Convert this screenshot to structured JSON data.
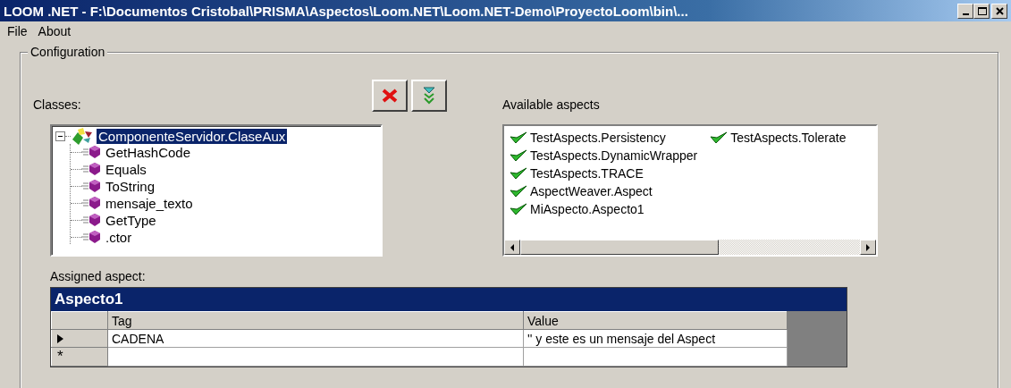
{
  "window": {
    "title": "LOOM .NET - F:\\Documentos Cristobal\\PRISMA\\Aspectos\\Loom.NET\\Loom.NET-Demo\\ProyectoLoom\\bin\\..."
  },
  "menu": [
    "File",
    "About"
  ],
  "configuration": {
    "title": "Configuration",
    "classes_label": "Classes:",
    "available_label": "Available aspects",
    "tree": {
      "label": "ComponenteServidor.ClaseAux",
      "expanded": true,
      "selected": true,
      "children": [
        {
          "label": "GetHashCode",
          "selected": false
        },
        {
          "label": "Equals",
          "selected": false
        },
        {
          "label": "ToString",
          "selected": false
        },
        {
          "label": "mensaje_texto",
          "selected": false
        },
        {
          "label": "GetType",
          "selected": false
        },
        {
          "label": ".ctor",
          "selected": false
        }
      ]
    },
    "aspects": [
      {
        "label": "TestAspects.Persistency"
      },
      {
        "label": "TestAspects.DynamicWrapper"
      },
      {
        "label": "TestAspects.TRACE"
      },
      {
        "label": "AspectWeaver.Aspect"
      },
      {
        "label": "MiAspecto.Aspecto1"
      },
      {
        "label": "TestAspects.Tolerate"
      }
    ],
    "assigned_label": "Assigned aspect:",
    "grid": {
      "caption": "Aspecto1",
      "columns": [
        "Tag",
        "Value"
      ],
      "rows": [
        {
          "tag": "CADENA",
          "value": "'' y este es un mensaje del Aspect",
          "current": true
        }
      ],
      "new_row_marker": "*"
    }
  }
}
